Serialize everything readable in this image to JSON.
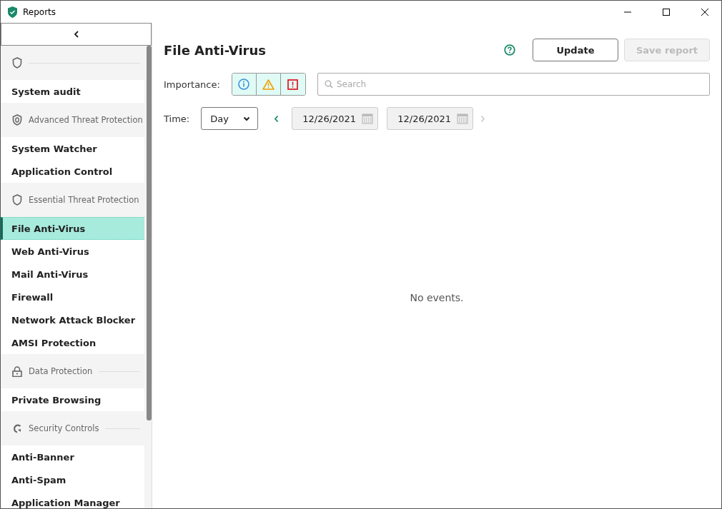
{
  "window": {
    "title": "Reports"
  },
  "sidebar": {
    "groups": [
      {
        "items": [
          {
            "label": "System audit",
            "selected": false
          }
        ]
      },
      {
        "label": "Advanced Threat Protection",
        "items": [
          {
            "label": "System Watcher",
            "selected": false
          },
          {
            "label": "Application Control",
            "selected": false
          }
        ]
      },
      {
        "label": "Essential Threat Protection",
        "items": [
          {
            "label": "File Anti-Virus",
            "selected": true
          },
          {
            "label": "Web Anti-Virus",
            "selected": false
          },
          {
            "label": "Mail Anti-Virus",
            "selected": false
          },
          {
            "label": "Firewall",
            "selected": false
          },
          {
            "label": "Network Attack Blocker",
            "selected": false
          },
          {
            "label": "AMSI Protection",
            "selected": false
          }
        ]
      },
      {
        "label": "Data Protection",
        "items": [
          {
            "label": "Private Browsing",
            "selected": false
          }
        ]
      },
      {
        "label": "Security Controls",
        "items": [
          {
            "label": "Anti-Banner",
            "selected": false
          },
          {
            "label": "Anti-Spam",
            "selected": false
          },
          {
            "label": "Application Manager",
            "selected": false
          }
        ]
      }
    ]
  },
  "main": {
    "title": "File Anti-Virus",
    "buttons": [
      {
        "label": "Update",
        "disabled": false
      },
      {
        "label": "Save report",
        "disabled": true
      }
    ],
    "importance": {
      "label": "Importance:",
      "levels": [
        {
          "kind": "info",
          "selected": true
        },
        {
          "kind": "warning",
          "selected": true
        },
        {
          "kind": "critical",
          "selected": true
        }
      ]
    },
    "search": {
      "placeholder": "Search"
    },
    "time": {
      "label": "Time:",
      "period": "Day",
      "from": "12/26/2021",
      "to": "12/26/2021",
      "prev_disabled": false,
      "next_disabled": true
    },
    "empty_message": "No events."
  }
}
